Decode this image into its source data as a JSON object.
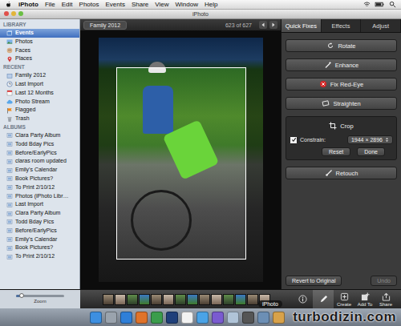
{
  "menu_bar": {
    "app": "iPhoto",
    "items": [
      "File",
      "Edit",
      "Photos",
      "Events",
      "Share",
      "View",
      "Window",
      "Help"
    ]
  },
  "window": {
    "title": "iPhoto"
  },
  "sidebar": {
    "sections": [
      {
        "title": "LIBRARY",
        "items": [
          {
            "label": "Events",
            "kind": "events",
            "selected": true
          },
          {
            "label": "Photos",
            "kind": "photos",
            "selected": false
          },
          {
            "label": "Faces",
            "kind": "faces",
            "selected": false
          },
          {
            "label": "Places",
            "kind": "places",
            "selected": false
          }
        ]
      },
      {
        "title": "RECENT",
        "items": [
          {
            "label": "Family 2012",
            "kind": "event",
            "selected": false
          },
          {
            "label": "Last Import",
            "kind": "import",
            "selected": false
          },
          {
            "label": "Last 12 Months",
            "kind": "calendar",
            "selected": false
          },
          {
            "label": "Photo Stream",
            "kind": "stream",
            "selected": false
          },
          {
            "label": "Flagged",
            "kind": "flag",
            "selected": false
          },
          {
            "label": "Trash",
            "kind": "trash",
            "selected": false
          }
        ]
      },
      {
        "title": "ALBUMS",
        "items": [
          {
            "label": "Clara Party Album",
            "kind": "album",
            "selected": false
          },
          {
            "label": "Todd Bday Pics",
            "kind": "album",
            "selected": false
          },
          {
            "label": "Before/EarlyPics",
            "kind": "album",
            "selected": false
          },
          {
            "label": "claras room updated",
            "kind": "album",
            "selected": false
          },
          {
            "label": "Emily's Calendar",
            "kind": "album",
            "selected": false
          },
          {
            "label": "Book Pictures?",
            "kind": "album",
            "selected": false
          },
          {
            "label": "To Print 2/10/12",
            "kind": "album",
            "selected": false
          },
          {
            "label": "Photos (iPhoto Libr…",
            "kind": "album",
            "selected": false
          },
          {
            "label": "Last Import",
            "kind": "album",
            "selected": false
          },
          {
            "label": "Clara Party Album",
            "kind": "album",
            "selected": false
          },
          {
            "label": "Todd Bday Pics",
            "kind": "album",
            "selected": false
          },
          {
            "label": "Before/EarlyPics",
            "kind": "album",
            "selected": false
          },
          {
            "label": "Emily's Calendar",
            "kind": "album",
            "selected": false
          },
          {
            "label": "Book Pictures?",
            "kind": "album",
            "selected": false
          },
          {
            "label": "To Print 2/10/12",
            "kind": "album",
            "selected": false
          }
        ]
      }
    ]
  },
  "viewer": {
    "event": "Family 2012",
    "counter": "623 of 627"
  },
  "edit_panel": {
    "tabs": [
      {
        "label": "Quick Fixes",
        "selected": true
      },
      {
        "label": "Effects",
        "selected": false
      },
      {
        "label": "Adjust",
        "selected": false
      }
    ],
    "tools": [
      {
        "label": "Rotate",
        "kind": "rotate"
      },
      {
        "label": "Enhance",
        "kind": "enhance"
      },
      {
        "label": "Fix Red-Eye",
        "kind": "redeye"
      },
      {
        "label": "Straighten",
        "kind": "straighten"
      }
    ],
    "crop": {
      "label": "Crop",
      "constrain": {
        "label": "Constrain:",
        "checked": true
      },
      "ratio": "1944 × 2896",
      "buttons": [
        "Reset",
        "Done"
      ]
    },
    "retouch": {
      "label": "Retouch"
    },
    "footer": [
      {
        "label": "Revert to Original",
        "disabled": false
      },
      {
        "label": "Undo",
        "disabled": true
      }
    ]
  },
  "toolbar": {
    "zoom": {
      "label": "Zoom",
      "level": 0.12
    },
    "tools": [
      {
        "kind": "info",
        "selected": false
      },
      {
        "kind": "edit",
        "selected": true
      },
      {
        "kind": "create",
        "label": "Create",
        "selected": false
      },
      {
        "kind": "addto",
        "label": "Add To",
        "selected": false
      },
      {
        "kind": "share",
        "label": "Share",
        "selected": false
      }
    ]
  },
  "dock": {
    "tooltip": "iPhoto",
    "apps": [
      {
        "color": "#3d8fe0"
      },
      {
        "color": "#9aa3ad"
      },
      {
        "color": "#2f7fd8"
      },
      {
        "color": "#e0732a"
      },
      {
        "color": "#3b9d4c"
      },
      {
        "color": "#1f3f7a"
      },
      {
        "color": "#f2f2f2"
      },
      {
        "color": "#4aa3e6"
      },
      {
        "color": "#7a5bd0"
      },
      {
        "color": "#b0c4d8"
      },
      {
        "color": "#555555"
      },
      {
        "color": "#6c8fb5"
      },
      {
        "color": "#d8a24a"
      }
    ]
  },
  "watermark": "turbodizin.com"
}
